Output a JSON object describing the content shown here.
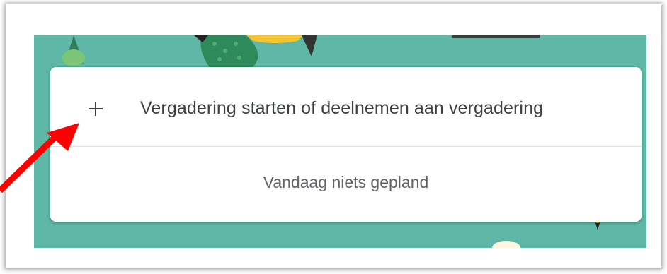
{
  "meeting_card": {
    "start_label": "Vergadering starten of deelnemen aan vergadering",
    "empty_message": "Vandaag niets gepland",
    "start_icon": "plus-icon"
  },
  "annotation": {
    "arrow_icon": "red-arrow-icon",
    "arrow_color": "#ff0000"
  },
  "colors": {
    "banner": "#5fb8a6",
    "card": "#ffffff",
    "text_primary": "#3c4043",
    "text_secondary": "#5f6368"
  }
}
